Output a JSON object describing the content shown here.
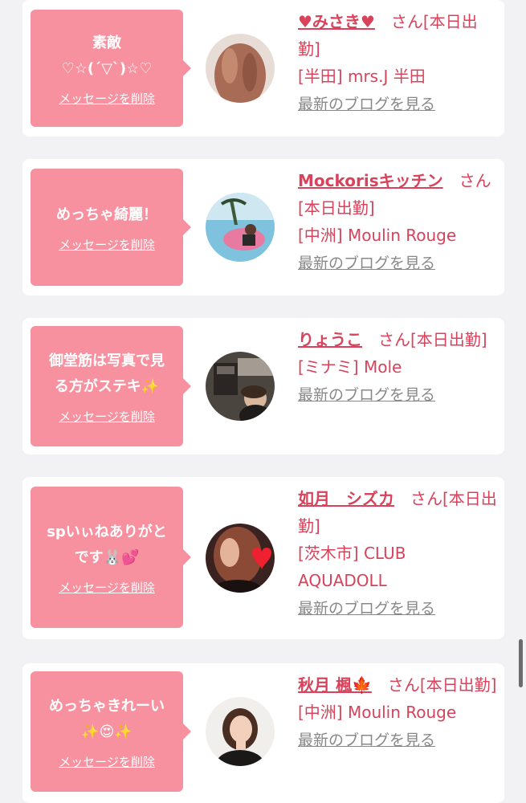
{
  "theme": {
    "accent": "#f7919f",
    "name_color": "#d8425b",
    "link_gray": "#888888"
  },
  "delete_label": "メッセージを削除",
  "blog_label": "最新のブログを見る",
  "cards": [
    {
      "message_line1": "素敵",
      "message_line2": "♡☆(´▽`)☆♡",
      "name": "♥みさき♥",
      "suffix": "　さん[本日出勤]",
      "shop": "[半田] mrs.J 半田"
    },
    {
      "message_line1": "めっちゃ綺麗！",
      "message_line2": "",
      "name": "Mockorisキッチン",
      "suffix": "　さん[本日出勤]",
      "shop": "[中洲] Moulin Rouge"
    },
    {
      "message_line1": "御堂筋は写真で見",
      "message_line2": "る方がステキ✨",
      "name": "りょうこ",
      "suffix": "　さん[本日出勤]",
      "shop": "[ミナミ] Mole"
    },
    {
      "message_line1": "spいぃねありがと",
      "message_line2": "です🐰💕",
      "name": "如月　シズカ",
      "suffix": "　さん[本日出勤]",
      "shop": "[茨木市] CLUB AQUADOLL"
    },
    {
      "message_line1": "めっちゃきれーい",
      "message_line2": "✨😍✨",
      "name": "秋月 楓🍁",
      "suffix": "　さん[本日出勤]",
      "shop": "[中洲] Moulin Rouge"
    }
  ]
}
